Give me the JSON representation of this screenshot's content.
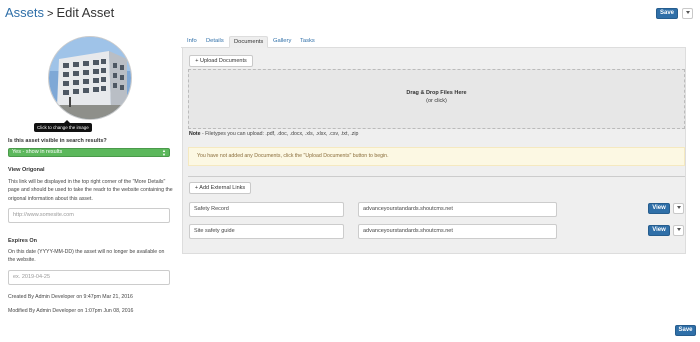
{
  "header": {
    "breadcrumb_parent": "Assets",
    "separator": ">",
    "page_title": "Edit Asset",
    "save_label": "Save"
  },
  "sidebar": {
    "image_tooltip": "Click to change the image",
    "visibility": {
      "label": "Is this asset visible in search results?",
      "value": "Yes - show in results",
      "color": "#5cb85c"
    },
    "original": {
      "heading": "View Origonal",
      "description": "This link will be displayed in the top right corner of the \"More Details\" page and should be used to take the readr to the website containing the origonal information about this asset.",
      "placeholder": "http://www.somesite.com"
    },
    "expires": {
      "heading": "Expires On",
      "description": "On this date (YYYY-MM-DD) the asset will no longer be available on the website.",
      "placeholder": "ex. 2019-04-25"
    },
    "created": "Created By Admin Developer on 9:47pm Mar 21, 2016",
    "modified": "Modified By Admin Developer on 1:07pm Jun 08, 2016"
  },
  "tabs": [
    {
      "label": "Info",
      "active": false
    },
    {
      "label": "Details",
      "active": false
    },
    {
      "label": "Documents",
      "active": true
    },
    {
      "label": "Gallery",
      "active": false
    },
    {
      "label": "Tasks",
      "active": false
    }
  ],
  "documents": {
    "upload_label": "+ Upload Documents",
    "dropzone_title": "Drag & Drop Files Here",
    "dropzone_sub": "(or click)",
    "note_bold": "Note",
    "note_text": " - Filetypes you can upload: .pdf, .doc, .docx, .xls, .xlsx, .csv, .txt, .zip",
    "empty_alert": "You have not added any Documents, click the \"Upload Documents\" button to begin.",
    "add_links_label": "+ Add External Links",
    "links": [
      {
        "name": "Safety Record",
        "url": "advanceyourstandards.shoutcms.net",
        "view_label": "View"
      },
      {
        "name": "Site safety guide",
        "url": "advanceyourstandards.shoutcms.net",
        "view_label": "View"
      }
    ]
  },
  "footer": {
    "save_label": "Save"
  },
  "colors": {
    "primary": "#2f6fa8",
    "link": "#2f6fa8",
    "alert_bg": "#fcf8e3",
    "success": "#5cb85c"
  }
}
